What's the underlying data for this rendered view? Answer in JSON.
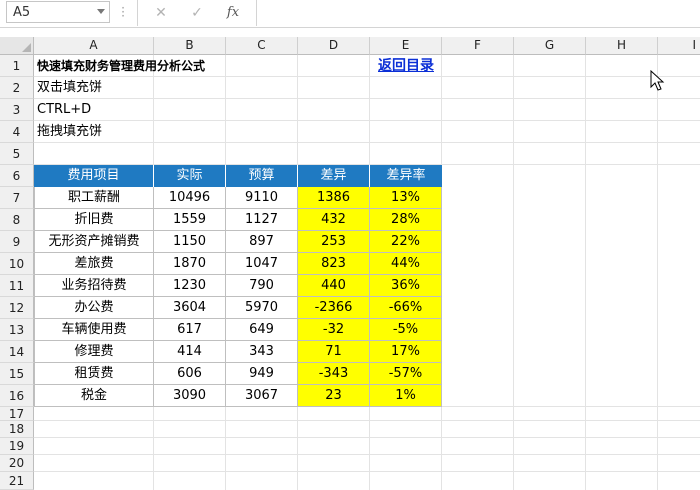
{
  "formula_bar": {
    "name_box": "A5",
    "cancel_icon": "✕",
    "enter_icon": "✓",
    "fx_label": "fx",
    "formula": ""
  },
  "columns": [
    "A",
    "B",
    "C",
    "D",
    "E",
    "F",
    "G",
    "H",
    "I"
  ],
  "rows": [
    "1",
    "2",
    "3",
    "4",
    "5",
    "6",
    "7",
    "8",
    "9",
    "10",
    "11",
    "12",
    "13",
    "14",
    "15",
    "16",
    "17",
    "18",
    "19",
    "20",
    "21"
  ],
  "sheet": {
    "a1": "快速填充财务管理费用分析公式",
    "e1_link": "返回目录",
    "a2": "双击填充饼",
    "a3": "CTRL+D",
    "a4": "拖拽填充饼"
  },
  "table": {
    "headers": [
      "费用项目",
      "实际",
      "预算",
      "差异",
      "差异率"
    ],
    "rows": [
      [
        "职工薪酬",
        "10496",
        "9110",
        "1386",
        "13%"
      ],
      [
        "折旧费",
        "1559",
        "1127",
        "432",
        "28%"
      ],
      [
        "无形资产摊销费",
        "1150",
        "897",
        "253",
        "22%"
      ],
      [
        "差旅费",
        "1870",
        "1047",
        "823",
        "44%"
      ],
      [
        "业务招待费",
        "1230",
        "790",
        "440",
        "36%"
      ],
      [
        "办公费",
        "3604",
        "5970",
        "-2366",
        "-66%"
      ],
      [
        "车辆使用费",
        "617",
        "649",
        "-32",
        "-5%"
      ],
      [
        "修理费",
        "414",
        "343",
        "71",
        "17%"
      ],
      [
        "租赁费",
        "606",
        "949",
        "-343",
        "-57%"
      ],
      [
        "税金",
        "3090",
        "3067",
        "23",
        "1%"
      ]
    ]
  },
  "colors": {
    "header_fill": "#1f7ac2",
    "highlight_fill": "#ffff00",
    "link": "#0b2fd6"
  }
}
